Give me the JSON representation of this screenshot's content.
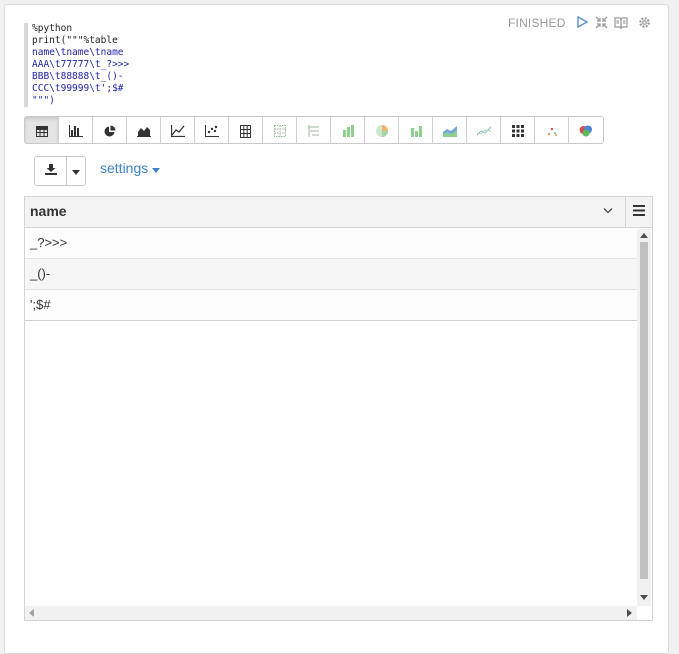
{
  "code": {
    "lines": [
      "%python",
      "print(\"\"\"%table",
      "name\\tname\\tname",
      "AAA\\t77777\\t_?>>>",
      "BBB\\t88888\\t_()-",
      "CCC\\t99999\\t';$#",
      "\"\"\")"
    ]
  },
  "status": "FINISHED",
  "controls": [
    "run-icon",
    "collapse-icon",
    "book-icon",
    "gear-icon"
  ],
  "toolbar": {
    "buttons": [
      "table-icon",
      "bar-chart-icon",
      "pie-chart-icon",
      "area-chart-icon",
      "line-chart-icon",
      "scatter-chart-icon",
      "pivot-table-icon",
      "table-grid-icon",
      "tree-icon",
      "bar-icon",
      "pie-icon",
      "column-icon",
      "area-icon",
      "line-icon",
      "grid-icon",
      "scatter-icon",
      "bubble-icon"
    ],
    "active_index": 0
  },
  "download_group": {
    "icon": "download-icon",
    "caret": "caret-down-icon"
  },
  "settings_label": "settings",
  "grid": {
    "column": "name",
    "rows": [
      "_?>>>",
      "_()-",
      "';$#"
    ]
  },
  "colors": {
    "link": "#3b83c4",
    "status": "#9a9a9a"
  }
}
